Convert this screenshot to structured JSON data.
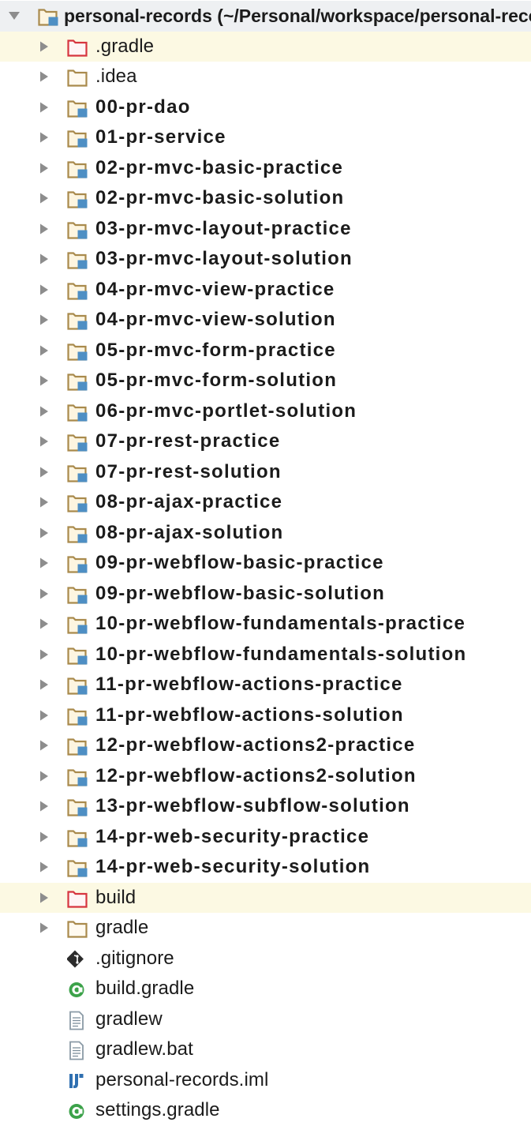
{
  "project_panel": {
    "items": [
      {
        "label": "personal-records (~/Personal/workspace/personal-records)",
        "kind": "project-root",
        "expanded": true,
        "bold": true,
        "highlight": false
      },
      {
        "label": ".gradle",
        "kind": "excluded-folder",
        "bold": false,
        "highlight": true
      },
      {
        "label": ".idea",
        "kind": "folder",
        "bold": false,
        "highlight": false
      },
      {
        "label": "00-pr-dao",
        "kind": "module",
        "bold": true,
        "highlight": false
      },
      {
        "label": "01-pr-service",
        "kind": "module",
        "bold": true,
        "highlight": false
      },
      {
        "label": "02-pr-mvc-basic-practice",
        "kind": "module",
        "bold": true,
        "highlight": false
      },
      {
        "label": "02-pr-mvc-basic-solution",
        "kind": "module",
        "bold": true,
        "highlight": false
      },
      {
        "label": "03-pr-mvc-layout-practice",
        "kind": "module",
        "bold": true,
        "highlight": false
      },
      {
        "label": "03-pr-mvc-layout-solution",
        "kind": "module",
        "bold": true,
        "highlight": false
      },
      {
        "label": "04-pr-mvc-view-practice",
        "kind": "module",
        "bold": true,
        "highlight": false
      },
      {
        "label": "04-pr-mvc-view-solution",
        "kind": "module",
        "bold": true,
        "highlight": false
      },
      {
        "label": "05-pr-mvc-form-practice",
        "kind": "module",
        "bold": true,
        "highlight": false
      },
      {
        "label": "05-pr-mvc-form-solution",
        "kind": "module",
        "bold": true,
        "highlight": false
      },
      {
        "label": "06-pr-mvc-portlet-solution",
        "kind": "module",
        "bold": true,
        "highlight": false
      },
      {
        "label": "07-pr-rest-practice",
        "kind": "module",
        "bold": true,
        "highlight": false
      },
      {
        "label": "07-pr-rest-solution",
        "kind": "module",
        "bold": true,
        "highlight": false
      },
      {
        "label": "08-pr-ajax-practice",
        "kind": "module",
        "bold": true,
        "highlight": false
      },
      {
        "label": "08-pr-ajax-solution",
        "kind": "module",
        "bold": true,
        "highlight": false
      },
      {
        "label": "09-pr-webflow-basic-practice",
        "kind": "module",
        "bold": true,
        "highlight": false
      },
      {
        "label": "09-pr-webflow-basic-solution",
        "kind": "module",
        "bold": true,
        "highlight": false
      },
      {
        "label": "10-pr-webflow-fundamentals-practice",
        "kind": "module",
        "bold": true,
        "highlight": false
      },
      {
        "label": "10-pr-webflow-fundamentals-solution",
        "kind": "module",
        "bold": true,
        "highlight": false
      },
      {
        "label": "11-pr-webflow-actions-practice",
        "kind": "module",
        "bold": true,
        "highlight": false
      },
      {
        "label": "11-pr-webflow-actions-solution",
        "kind": "module",
        "bold": true,
        "highlight": false
      },
      {
        "label": "12-pr-webflow-actions2-practice",
        "kind": "module",
        "bold": true,
        "highlight": false
      },
      {
        "label": "12-pr-webflow-actions2-solution",
        "kind": "module",
        "bold": true,
        "highlight": false
      },
      {
        "label": "13-pr-webflow-subflow-solution",
        "kind": "module",
        "bold": true,
        "highlight": false
      },
      {
        "label": "14-pr-web-security-practice",
        "kind": "module",
        "bold": true,
        "highlight": false
      },
      {
        "label": "14-pr-web-security-solution",
        "kind": "module",
        "bold": true,
        "highlight": false
      },
      {
        "label": "build",
        "kind": "excluded-folder",
        "bold": false,
        "highlight": true
      },
      {
        "label": "gradle",
        "kind": "folder",
        "bold": false,
        "highlight": false
      },
      {
        "label": ".gitignore",
        "kind": "git-file",
        "bold": false,
        "highlight": false
      },
      {
        "label": "build.gradle",
        "kind": "gradle-file",
        "bold": false,
        "highlight": false
      },
      {
        "label": "gradlew",
        "kind": "text-file",
        "bold": false,
        "highlight": false
      },
      {
        "label": "gradlew.bat",
        "kind": "text-file",
        "bold": false,
        "highlight": false
      },
      {
        "label": "personal-records.iml",
        "kind": "iml-file",
        "bold": false,
        "highlight": false
      },
      {
        "label": "settings.gradle",
        "kind": "gradle-file",
        "bold": false,
        "highlight": false
      }
    ]
  },
  "colors": {
    "row_highlight": "#fcf9e3",
    "root_row_background": "#eef0f2",
    "module_folder_outline": "#a98a4c",
    "module_badge": "#4e8fc4",
    "excluded_folder": "#d6353f",
    "gradle_green": "#3ca24a"
  }
}
